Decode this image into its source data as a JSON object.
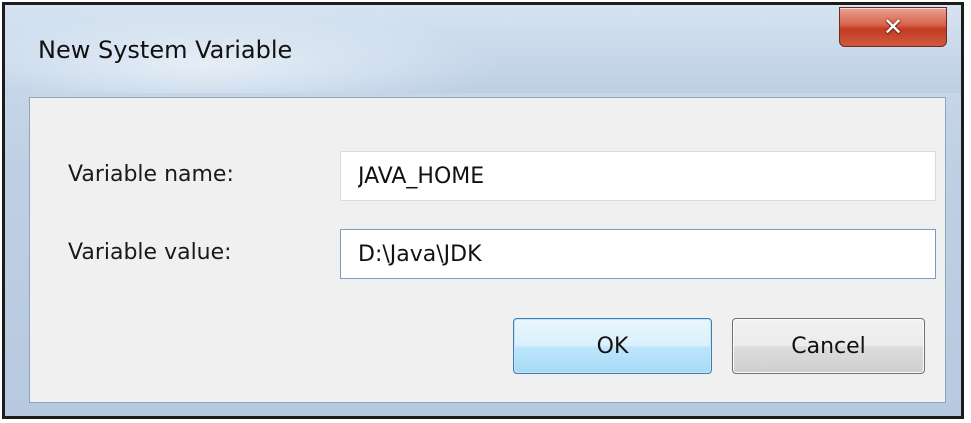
{
  "window": {
    "title": "New System Variable",
    "close_icon": "close-icon"
  },
  "form": {
    "variable_name_label": "Variable name:",
    "variable_name_value": "JAVA_HOME",
    "variable_value_label": "Variable value:",
    "variable_value_value": "D:\\Java\\JDK"
  },
  "buttons": {
    "ok_label": "OK",
    "cancel_label": "Cancel"
  },
  "colors": {
    "titlebar": "#c8d8ea",
    "close_button": "#c23b22",
    "client_bg": "#f0f0f0",
    "ok_button": "#bee6fd"
  }
}
